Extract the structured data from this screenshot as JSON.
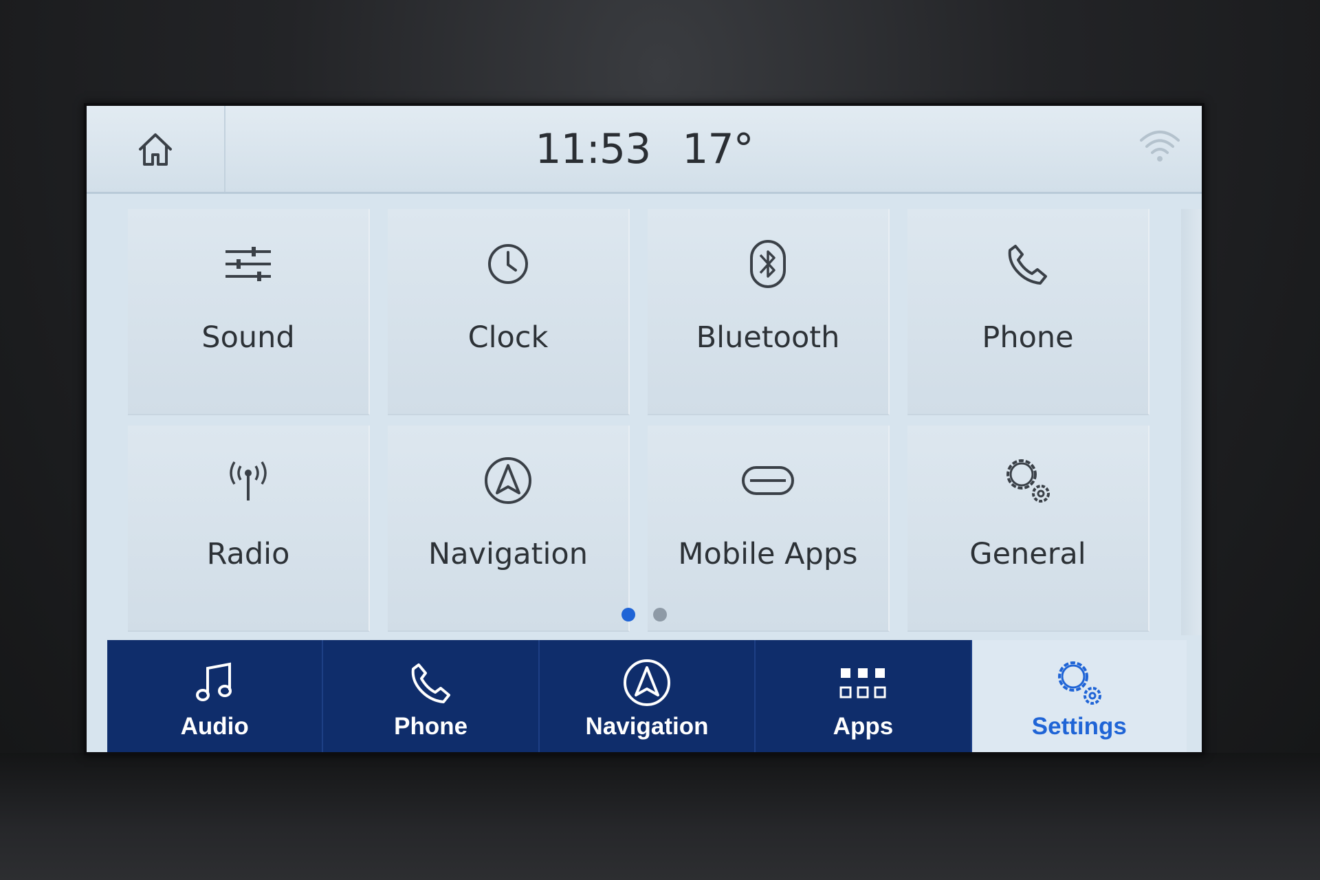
{
  "status_bar": {
    "home_icon": "home-icon",
    "time": "11:53",
    "temperature": "17°",
    "wifi_icon": "wifi-icon"
  },
  "settings_tiles": [
    {
      "label": "Sound",
      "icon": "equalizer-sliders-icon"
    },
    {
      "label": "Clock",
      "icon": "clock-icon"
    },
    {
      "label": "Bluetooth",
      "icon": "bluetooth-icon"
    },
    {
      "label": "Phone",
      "icon": "phone-icon"
    },
    {
      "label": "Radio",
      "icon": "radio-antenna-icon"
    },
    {
      "label": "Navigation",
      "icon": "navigation-arrow-icon"
    },
    {
      "label": "Mobile Apps",
      "icon": "link-icon"
    },
    {
      "label": "General",
      "icon": "gears-icon"
    }
  ],
  "pagination": {
    "pages": 2,
    "current": 1
  },
  "bottom_nav": [
    {
      "label": "Audio",
      "icon": "music-note-icon",
      "active": false
    },
    {
      "label": "Phone",
      "icon": "phone-icon",
      "active": false
    },
    {
      "label": "Navigation",
      "icon": "navigation-arrow-icon",
      "active": false
    },
    {
      "label": "Apps",
      "icon": "app-grid-icon",
      "active": false
    },
    {
      "label": "Settings",
      "icon": "gears-icon",
      "active": true
    }
  ],
  "colors": {
    "nav_background": "#0f2d6b",
    "active_accent": "#1f64d6",
    "screen_background": "#d7e4ee",
    "dot_active": "#1f64d6",
    "dot_inactive": "#8e9aa6"
  }
}
